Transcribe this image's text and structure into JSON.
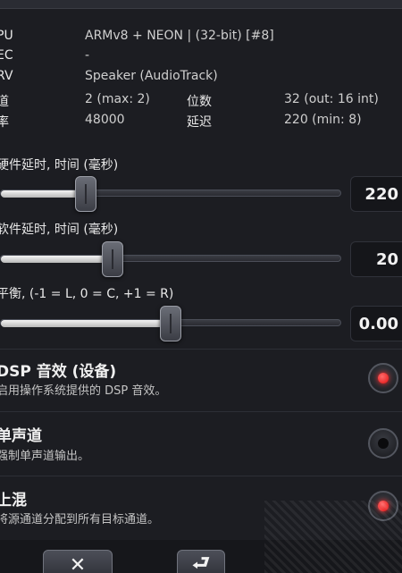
{
  "info": {
    "cpu_key": "PU",
    "cpu_val": "ARMv8 + NEON | (32-bit) [#8]",
    "sec_key": "EC",
    "sec_val": "-",
    "srv_key": "RV",
    "srv_val": "Speaker (AudioTrack)",
    "ch_key": "道",
    "ch_val": "2 (max: 2)",
    "bits_key": "位数",
    "bits_val": "32 (out: 16 int)",
    "rate_key": "率",
    "rate_val": "48000",
    "lat_key": "延迟",
    "lat_val": "220 (min: 8)"
  },
  "sliders": {
    "hw_label": "硬件延时, 时间 (毫秒)",
    "hw_value": "220",
    "hw_fraction": 0.23,
    "sw_label": "软件延时, 时间 (毫秒)",
    "sw_value": "20",
    "sw_fraction": 0.31,
    "bal_label": "平衡, (-1 = L, 0 = C, +1 = R)",
    "bal_value": "0.00",
    "bal_fraction": 0.48
  },
  "options": [
    {
      "title": "DSP 音效 (设备)",
      "desc": "启用操作系统提供的 DSP 音效。",
      "checked": true
    },
    {
      "title": "单声道",
      "desc": "强制单声道输出。",
      "checked": false
    },
    {
      "title": "上混",
      "desc": "将源通道分配到所有目标通道。",
      "checked": true
    }
  ],
  "buttons": {
    "close_glyph": "✕",
    "back_glyph": "⮐"
  },
  "colors": {
    "background": "#1c1d22",
    "radio_on": "#e01010",
    "fill": "#e8e8e8"
  }
}
